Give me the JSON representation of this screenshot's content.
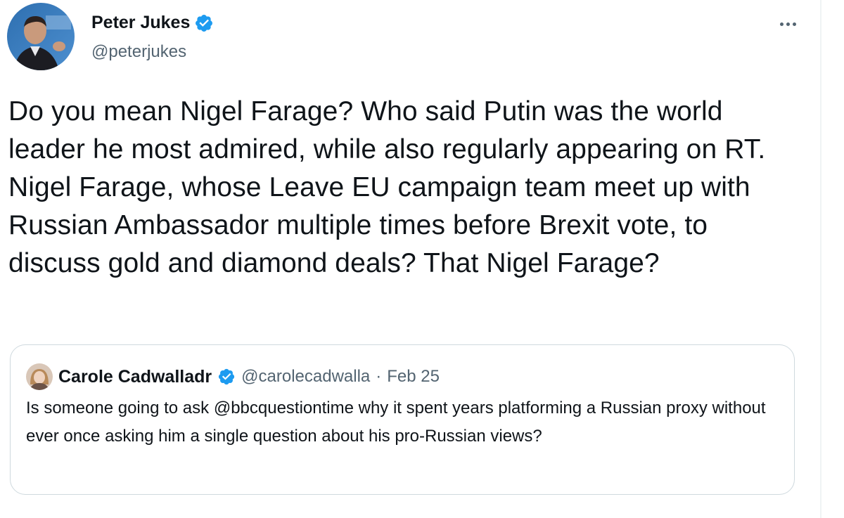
{
  "tweet": {
    "author": {
      "name": "Peter Jukes",
      "handle": "@peterjukes",
      "avatar_icon": "profile-photo",
      "verified_icon": "verified-badge-icon"
    },
    "more_icon": "more-options-icon",
    "text": "Do you mean Nigel Farage? Who said Putin was the world leader he most admired, while also regularly appearing on RT. Nigel Farage, whose Leave EU campaign team meet up with Russian Ambassador multiple times before Brexit vote, to discuss gold and diamond deals? That Nigel Farage?"
  },
  "quote": {
    "author": {
      "name": "Carole Cadwalladr",
      "handle": "@carolecadwalla",
      "avatar_icon": "profile-photo",
      "verified_icon": "verified-badge-icon"
    },
    "separator": "·",
    "date": "Feb 25",
    "text": "Is someone going to ask @bbcquestiontime why it spent years platforming a Russian proxy without ever once asking him a single question about his pro-Russian views?"
  },
  "colors": {
    "verified_blue": "#1d9bf0",
    "text_primary": "#0f1419",
    "text_secondary": "#536471",
    "border": "#cfd9de"
  }
}
